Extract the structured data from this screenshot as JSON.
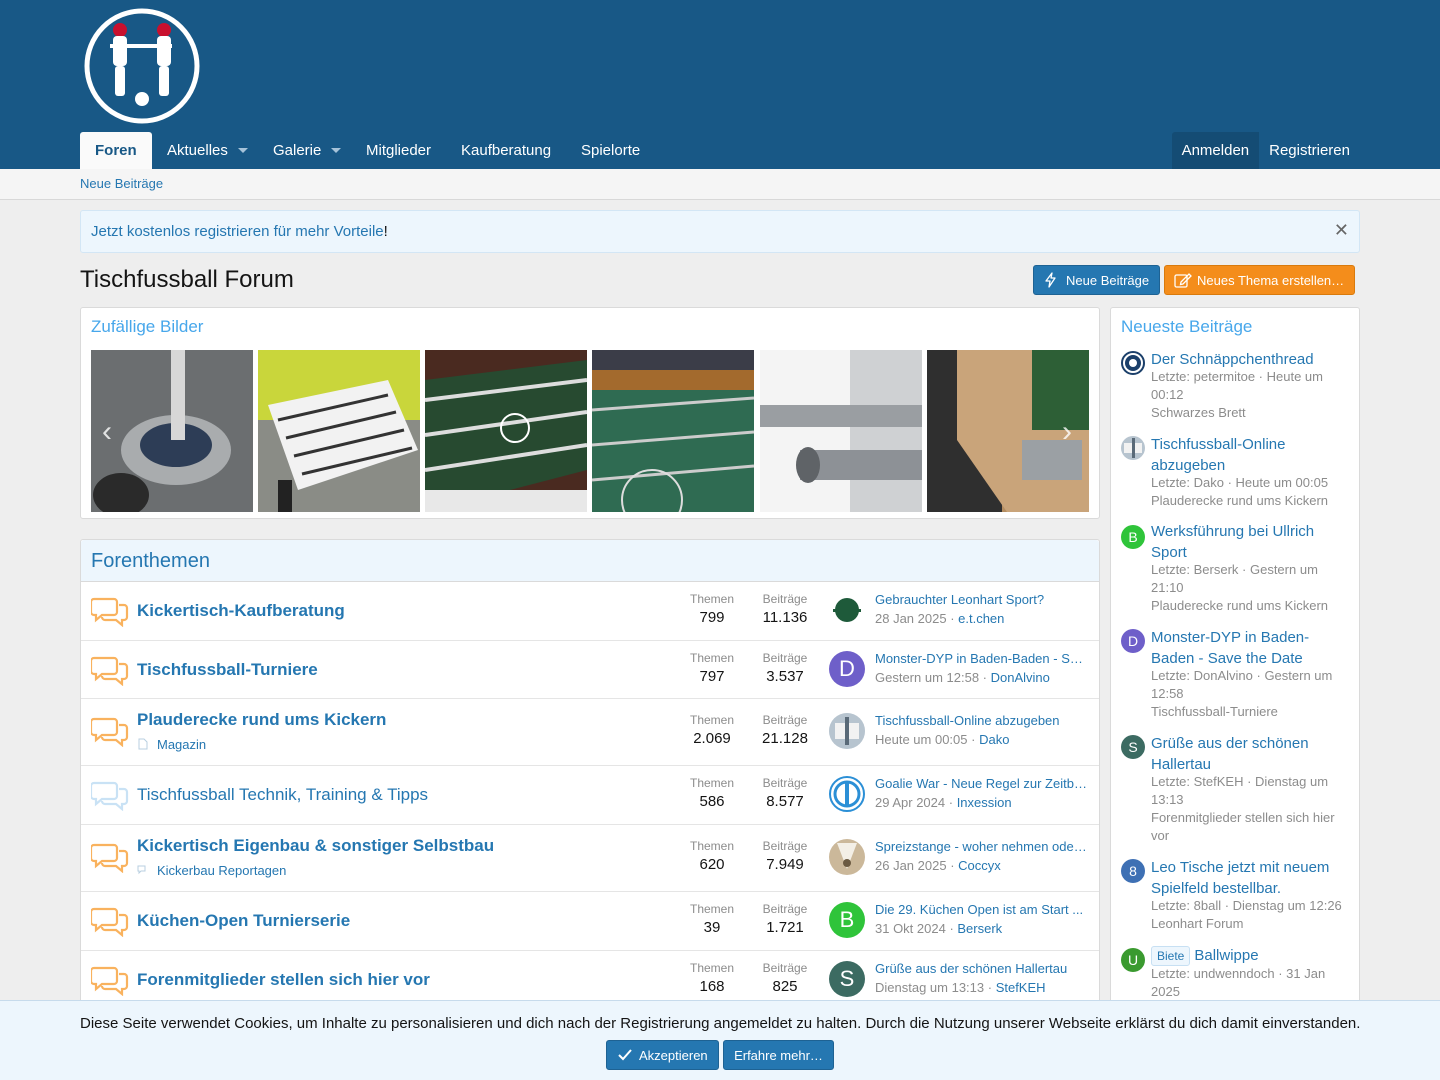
{
  "nav": {
    "tabs": [
      "Foren",
      "Aktuelles",
      "Galerie",
      "Mitglieder",
      "Kaufberatung",
      "Spielorte"
    ],
    "login": "Anmelden",
    "register": "Registrieren"
  },
  "subnav": {
    "new_posts": "Neue Beiträge"
  },
  "notice": {
    "link": "Jetzt kostenlos registrieren für mehr Vorteile",
    "suffix": "!"
  },
  "page": {
    "title": "Tischfussball Forum",
    "btn_new_posts": "Neue Beiträge",
    "btn_new_thread": "Neues Thema erstellen…"
  },
  "gallery": {
    "title": "Zufällige Bilder"
  },
  "forums": {
    "title": "Forenthemen",
    "label_threads": "Themen",
    "label_posts": "Beiträge",
    "rows": [
      {
        "name": "Kickertisch-Kaufberatung",
        "threads": "799",
        "posts": "11.136",
        "last_title": "Gebrauchter Leonhart Sport?",
        "last_date": "28 Jan 2025",
        "last_user": "e.t.chen"
      },
      {
        "name": "Tischfussball-Turniere",
        "threads": "797",
        "posts": "3.537",
        "last_title": "Monster-DYP in Baden-Baden - Save the Date",
        "last_date": "Gestern um 12:58",
        "last_user": "DonAlvino",
        "avatar_letter": "D"
      },
      {
        "name": "Plauderecke rund ums Kickern",
        "sub": "Magazin",
        "threads": "2.069",
        "posts": "21.128",
        "last_title": "Tischfussball-Online abzugeben",
        "last_date": "Heute um 00:05",
        "last_user": "Dako"
      },
      {
        "name": "Tischfussball Technik, Training & Tipps",
        "threads": "586",
        "posts": "8.577",
        "last_title": "Goalie War - Neue Regel zur Zeitbegrenzung",
        "last_date": "29 Apr 2024",
        "last_user": "Inxession"
      },
      {
        "name": "Kickertisch Eigenbau & sonstiger Selbstbau",
        "sub": "Kickerbau Reportagen",
        "threads": "620",
        "posts": "7.949",
        "last_title": "Spreizstange - woher nehmen oder selbst bauen?",
        "last_date": "26 Jan 2025",
        "last_user": "Coccyx"
      },
      {
        "name": "Küchen-Open Turnierserie",
        "threads": "39",
        "posts": "1.721",
        "last_title": "Die 29. Küchen Open ist am Start ...",
        "last_date": "31 Okt 2024",
        "last_user": "Berserk",
        "avatar_letter": "B"
      },
      {
        "name": "Forenmitglieder stellen sich hier vor",
        "threads": "168",
        "posts": "825",
        "last_title": "Grüße aus der schönen Hallertau",
        "last_date": "Dienstag um 13:13",
        "last_user": "StefKEH",
        "avatar_letter": "S"
      }
    ]
  },
  "sidebar": {
    "title": "Neueste Beiträge",
    "items": [
      {
        "title": "Der Schnäppchenthread",
        "meta": "Letzte: petermitoe · Heute um 00:12",
        "forum": "Schwarzes Brett"
      },
      {
        "title": "Tischfussball-Online abzugeben",
        "meta": "Letzte: Dako · Heute um 00:05",
        "forum": "Plauderecke rund ums Kickern"
      },
      {
        "title": "Werksführung bei Ullrich Sport",
        "meta": "Letzte: Berserk · Gestern um 21:10",
        "forum": "Plauderecke rund ums Kickern",
        "letter": "B"
      },
      {
        "title": "Monster-DYP in Baden-Baden - Save the Date",
        "meta": "Letzte: DonAlvino · Gestern um 12:58",
        "forum": "Tischfussball-Turniere",
        "letter": "D"
      },
      {
        "title": "Grüße aus der schönen Hallertau",
        "meta": "Letzte: StefKEH · Dienstag um 13:13",
        "forum": "Forenmitglieder stellen sich hier vor",
        "letter": "S"
      },
      {
        "title": "Leo Tische jetzt mit neuem Spielfeld bestellbar.",
        "meta": "Letzte: 8ball · Dienstag um 12:26",
        "forum": "Leonhart Forum",
        "letter": "8"
      },
      {
        "badge": "Biete",
        "title": "Ballwippe",
        "meta": "Letzte: undwenndoch · 31 Jan 2025",
        "letter": "U"
      }
    ]
  },
  "cookie": {
    "text": "Diese Seite verwendet Cookies, um Inhalte zu personalisieren und dich nach der Registrierung angemeldet zu halten. Durch die Nutzung unserer Webseite erklärst du dich damit einverstanden.",
    "accept": "Akzeptieren",
    "more": "Erfahre mehr…"
  },
  "colors": {
    "header": "#185886",
    "link": "#2577b1",
    "accent": "#47a7eb",
    "orange": "#f48d1b"
  }
}
